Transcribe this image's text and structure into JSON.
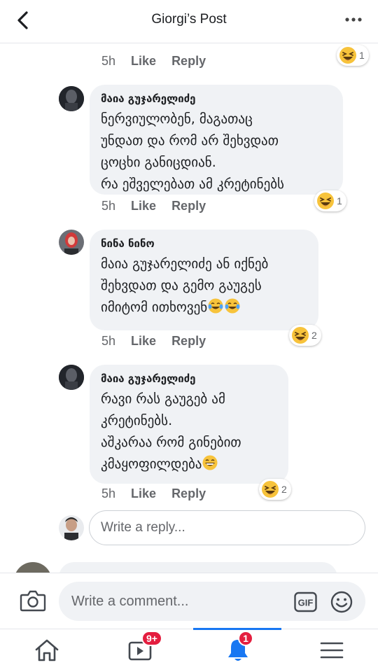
{
  "header": {
    "title": "Giorgi’s Post",
    "back_icon": "back-chevron-icon",
    "more_icon": "more-horizontal-icon"
  },
  "actions": {
    "like": "Like",
    "reply": "Reply"
  },
  "comments": [
    {
      "time": "5h",
      "reaction": "laughing",
      "reaction_count": "1"
    },
    {
      "author": "მაია გუჯარელიძე",
      "text": "ნერვიულობენ, მაგათაც\nუნდათ და რომ არ შეხვდათ\nცოცხი განიცდიან.\nრა ეშველებათ ამ კრეტინებს",
      "time": "5h",
      "reaction": "laughing",
      "reaction_count": "1"
    },
    {
      "author": "ნინა ნინო",
      "text": "მაია გუჯარელიძე ან იქნებ\nშეხვდათ და გემო გაუგეს\nიმიტომ ითხოვენ",
      "emoji_tail": "tears-of-joy x2",
      "time": "5h",
      "reaction": "laughing",
      "reaction_count": "2"
    },
    {
      "author": "მაია გუჯარელიძე",
      "text": "რავი რას გაუგებ ამ\nკრეტინებს.\nაშკარაა რომ გინებით\nკმაყოფილდება",
      "emoji_tail": "grinning",
      "time": "5h",
      "reaction": "laughing",
      "reaction_count": "2"
    }
  ],
  "reply_box": {
    "placeholder": "Write a reply..."
  },
  "composer": {
    "placeholder": "Write a comment...",
    "gif_label": "GIF"
  },
  "tabs": {
    "home_icon": "home-icon",
    "video_badge": "9+",
    "notifications_badge": "1",
    "menu_icon": "menu-icon"
  },
  "colors": {
    "accent": "#1877f2",
    "badge": "#e41e3f",
    "bubble": "#f0f2f5",
    "meta": "#65676b"
  }
}
